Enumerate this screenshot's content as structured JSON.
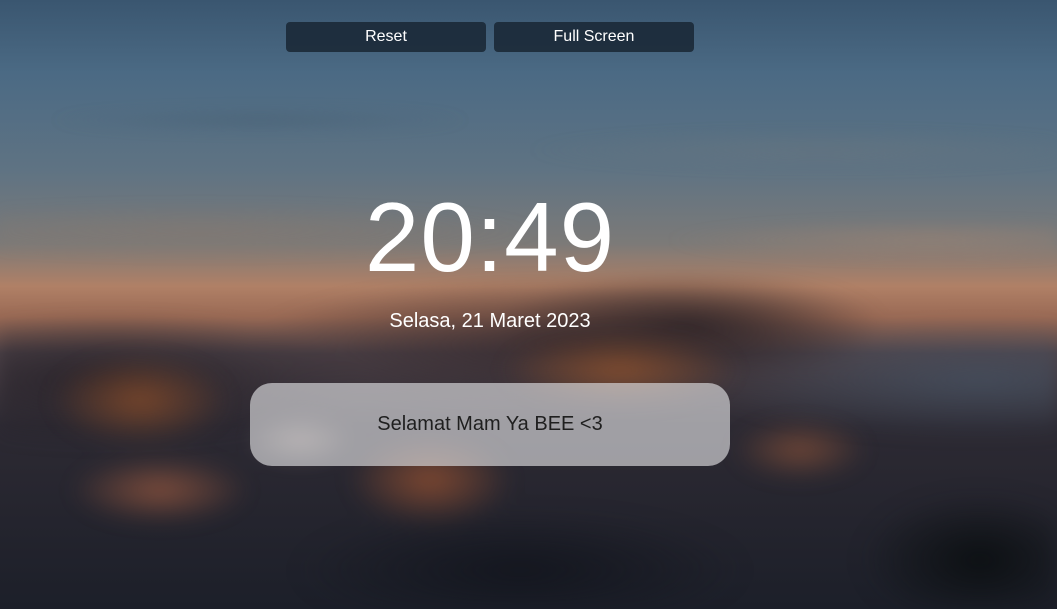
{
  "toolbar": {
    "reset_label": "Reset",
    "fullscreen_label": "Full Screen"
  },
  "clock": {
    "time": "20:49",
    "date": "Selasa, 21 Maret 2023"
  },
  "message": {
    "text": "Selamat Mam Ya BEE <3"
  },
  "colors": {
    "button_bg": "#1b2937",
    "text_primary": "#ffffff",
    "message_text": "#1f1f1f"
  }
}
